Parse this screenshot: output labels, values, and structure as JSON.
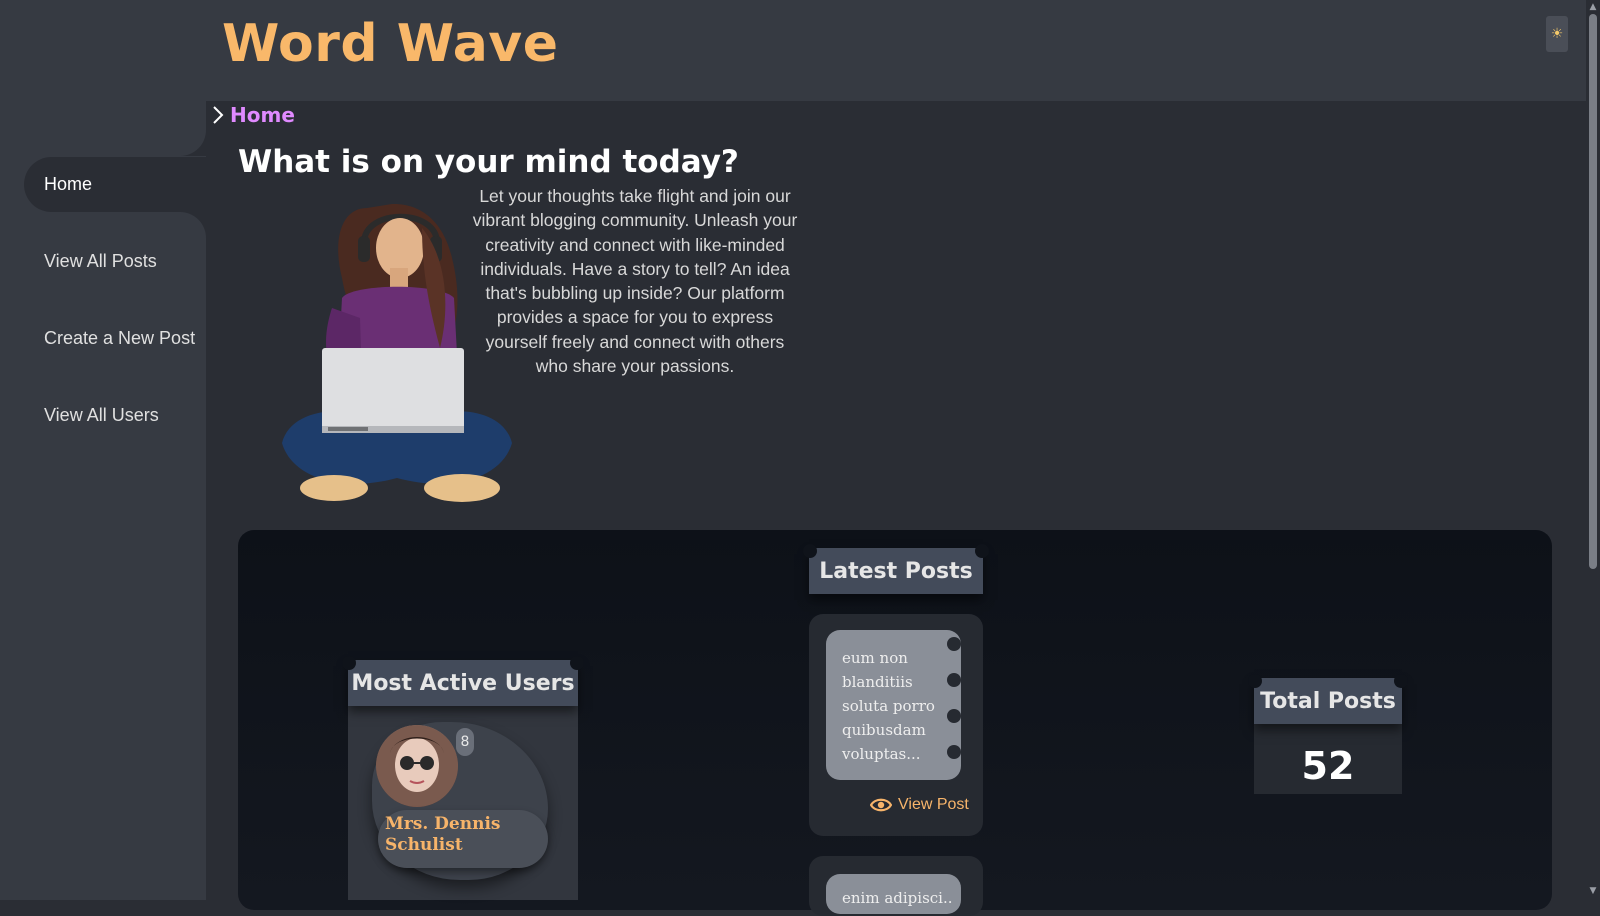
{
  "app": {
    "title": "Word Wave"
  },
  "theme_toggle": {
    "icon": "sun-icon",
    "glyph": "☀"
  },
  "sidebar": {
    "items": [
      {
        "label": "Home",
        "active": true
      },
      {
        "label": "View All Posts",
        "active": false
      },
      {
        "label": "Create a New Post",
        "active": false
      },
      {
        "label": "View All Users",
        "active": false
      }
    ]
  },
  "breadcrumb": {
    "icon": "chevron-right-icon",
    "label": "Home"
  },
  "hero": {
    "title": "What is on your mind today?",
    "text": "Let your thoughts take flight and join our vibrant blogging community. Unleash your creativity and connect with like-minded individuals. Have a story to tell? An idea that's bubbling up inside? Our platform provides a space for you to express yourself freely and connect with others who share your passions."
  },
  "most_active_users": {
    "title": "Most Active Users",
    "users": [
      {
        "name": "Mrs. Dennis Schulist",
        "count": "8"
      }
    ]
  },
  "latest_posts": {
    "title": "Latest Posts",
    "posts": [
      {
        "excerpt": "eum non blanditiis soluta porro quibusdam voluptas...",
        "action": "View Post"
      },
      {
        "excerpt": "enim adipisci..."
      }
    ]
  },
  "total_posts": {
    "title": "Total Posts",
    "value": "52"
  },
  "colors": {
    "accent": "#f9b86a",
    "breadcrumb": "#e08aff",
    "background": "#2a2d34",
    "panel": "#363a42"
  }
}
